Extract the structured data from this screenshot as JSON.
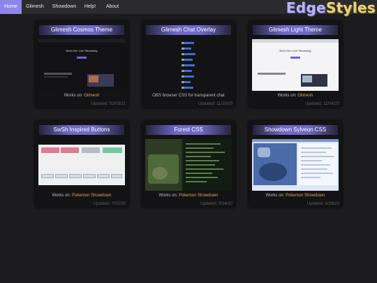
{
  "nav": {
    "items": [
      {
        "label": "Home",
        "active": true
      },
      {
        "label": "Glimesh",
        "active": false
      },
      {
        "label": "Showdown",
        "active": false
      },
      {
        "label": "Help!",
        "active": false
      },
      {
        "label": "About",
        "active": false
      }
    ]
  },
  "logo": {
    "part1": "Edge",
    "part2": "Styles"
  },
  "colors": {
    "accent": "#8c86ea",
    "link": "#d6a94c",
    "background": "#1c1c1e"
  },
  "cards": [
    {
      "title": "Glimesh Cosmos Theme",
      "works_prefix": "Works on: ",
      "works_link": "Glimesh",
      "description": "",
      "updated": "Updated: 02/03/21",
      "thumb_text": "Next-Gen Live Streaming"
    },
    {
      "title": "Glimesh Chat Overlay",
      "works_prefix": "",
      "works_link": "",
      "description": "OBS browser CSS for transparent chat",
      "updated": "Updated: 11/20/20"
    },
    {
      "title": "Glimesh Light Theme",
      "works_prefix": "Works on: ",
      "works_link": "Glimesh",
      "description": "",
      "updated": "Updated: 11/04/20",
      "thumb_text": "Next-Gen Live Streaming"
    },
    {
      "title": "SwSh Inspired Buttons",
      "works_prefix": "Works on: ",
      "works_link": "Pokemon Showdown",
      "description": "",
      "updated": "Updated: ?/02/20"
    },
    {
      "title": "Forest CSS",
      "works_prefix": "Works on: ",
      "works_link": "Pokemon Showdown",
      "description": "",
      "updated": "Updated: 9/24/20"
    },
    {
      "title": "Showdown Sylveon CSS",
      "works_prefix": "Works on: ",
      "works_link": "Pokemon Showdown",
      "description": "",
      "updated": "Updated: 8/26/20"
    }
  ]
}
